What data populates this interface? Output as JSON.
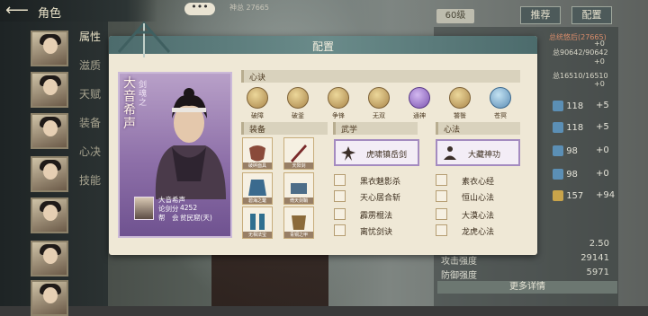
{
  "header": {
    "back_glyph": "⟵",
    "title": "角色"
  },
  "left_tabs": [
    {
      "label": "属性",
      "active": true
    },
    {
      "label": "滋质",
      "active": false
    },
    {
      "label": "天赋",
      "active": false
    },
    {
      "label": "装备",
      "active": false
    },
    {
      "label": "心决",
      "active": false
    },
    {
      "label": "技能",
      "active": false
    }
  ],
  "top_right": {
    "pill_label": "60级",
    "buttons": [
      "推荐",
      "配置"
    ],
    "dots_label": "•••",
    "behind_header": "神总 27665",
    "red_line": "总统悠后(27665)",
    "lines": [
      "+0",
      "总90642/90642",
      "+0",
      "总16510/16510",
      "+0"
    ],
    "stats": [
      {
        "value": "118",
        "delta": "+5"
      },
      {
        "value": "118",
        "delta": "+5"
      },
      {
        "value": "98",
        "delta": "+0"
      },
      {
        "value": "98",
        "delta": "+0"
      },
      {
        "value": "157",
        "delta": "+94"
      }
    ],
    "bottom_stats": [
      {
        "label": "",
        "value": "2.50"
      },
      {
        "label": "攻击强度",
        "value": "29141"
      },
      {
        "label": "防御强度",
        "value": "5971"
      }
    ],
    "more_label": "更多详情"
  },
  "modal": {
    "title": "配置",
    "char": {
      "name": "大音希声",
      "subtitle": "剑魂之",
      "info_name": "大音希声",
      "score_label": "论剑分",
      "score_value": "4252",
      "guild_label": "帮　会",
      "guild_value": "贫民窟(天)"
    },
    "xinjue": {
      "label": "心诀",
      "items": [
        {
          "label": "破障",
          "icon": "gold-disc-icon"
        },
        {
          "label": "破釜",
          "icon": "gold-disc-icon"
        },
        {
          "label": "争锋",
          "icon": "gold-disc-icon"
        },
        {
          "label": "无双",
          "icon": "gold-disc-icon"
        },
        {
          "label": "通神",
          "icon": "purple-disc-icon"
        },
        {
          "label": "饕餮",
          "icon": "gold-disc-icon"
        },
        {
          "label": "苍冥",
          "icon": "blue-disc-icon"
        }
      ]
    },
    "equip": {
      "label": "装备",
      "tags": [
        "破碎面具",
        "天阳剑",
        "碧海之氅",
        "倚天剑鞘",
        "无相法宝",
        "青铜之甲"
      ]
    },
    "wuxue": {
      "label": "武学",
      "main": "虎啸镇岳剑",
      "items": [
        "黑衣魅影杀",
        "天心居合斩",
        "霹雳棍法",
        "离忧剑诀"
      ]
    },
    "xinfa": {
      "label": "心法",
      "main": "大藏神功",
      "items": [
        "素衣心经",
        "恒山心法",
        "大漠心法",
        "龙虎心法"
      ]
    }
  },
  "colors": {
    "accent": "#4c6b6c",
    "purple_frame": "#a48bc0",
    "parchment": "#efe8d6"
  }
}
